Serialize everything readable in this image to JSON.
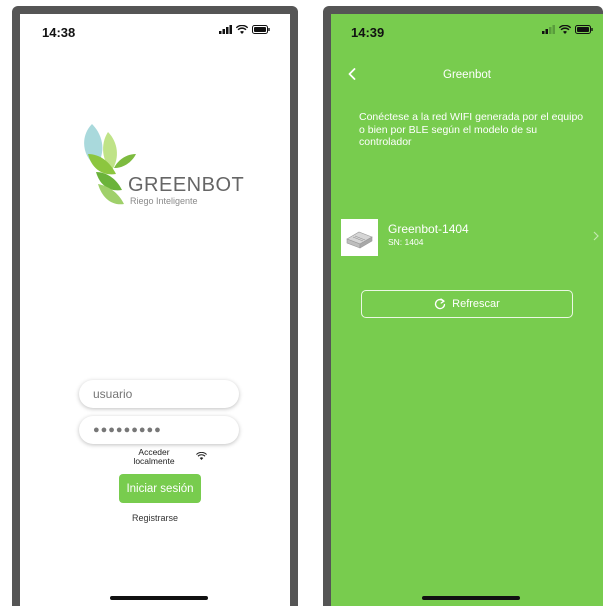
{
  "left_screen": {
    "status_bar": {
      "time": "14:38"
    },
    "brand": {
      "name": "GREENBOT",
      "tagline": "Riego Inteligente"
    },
    "login": {
      "username_placeholder": "usuario",
      "password_mask": "●●●●●●●●●",
      "local_access_label": "Acceder localmente",
      "login_button_label": "Iniciar sesión",
      "register_label": "Registrarse"
    }
  },
  "right_screen": {
    "status_bar": {
      "time": "14:39"
    },
    "nav": {
      "title": "Greenbot"
    },
    "instructions": "Conéctese a la red WIFI generada por el equipo o bien por BLE según el modelo de su controlador",
    "devices": [
      {
        "name": "Greenbot-1404",
        "serial": "SN: 1404"
      }
    ],
    "refresh_button_label": "Refrescar"
  },
  "colors": {
    "brand_green": "#78cc4e",
    "frame_gray": "#555555"
  },
  "icons": [
    "signal-icon",
    "wifi-icon",
    "battery-icon",
    "back-icon",
    "chevron-right-icon",
    "refresh-icon",
    "leaf-logo-icon"
  ]
}
